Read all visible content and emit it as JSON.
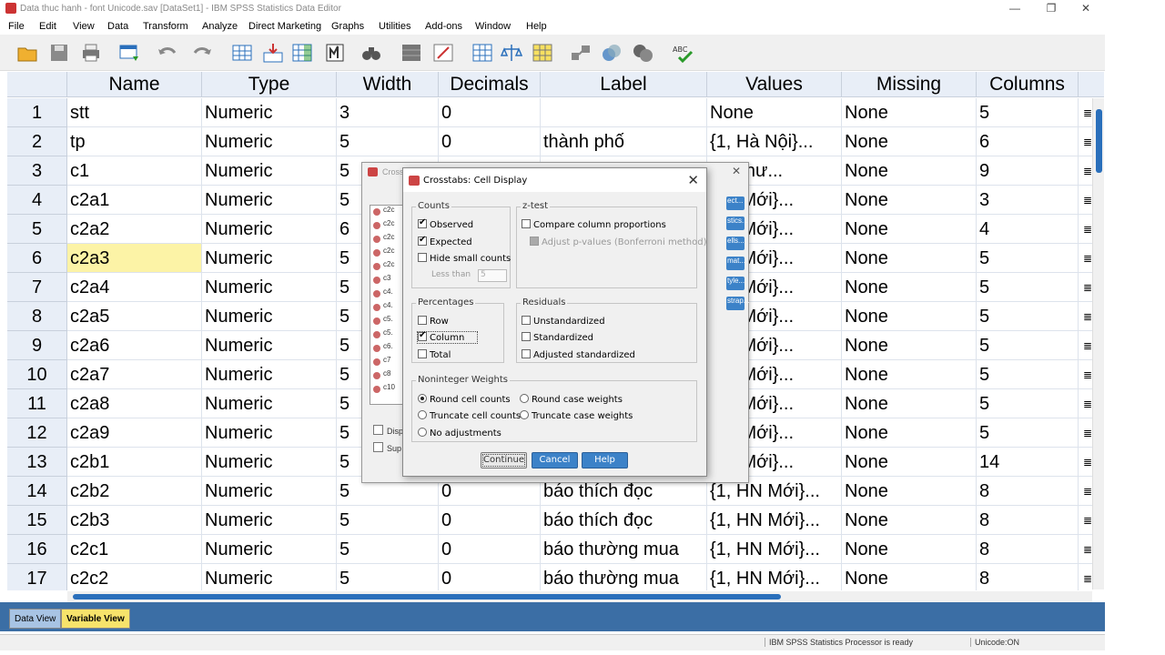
{
  "window": {
    "title": "Data thuc hanh - font Unicode.sav [DataSet1] - IBM SPSS Statistics Data Editor",
    "minimize": "—",
    "restore": "❐",
    "close": "✕"
  },
  "menu": [
    "File",
    "Edit",
    "View",
    "Data",
    "Transform",
    "Analyze",
    "Direct Marketing",
    "Graphs",
    "Utilities",
    "Add-ons",
    "Window",
    "Help"
  ],
  "toolbar_icons": [
    "open-icon",
    "save-icon",
    "print-icon",
    "recall-dialog-icon",
    "undo-icon",
    "redo-icon",
    "goto-case-icon",
    "goto-variable-icon",
    "variables-icon",
    "run-descriptive-icon",
    "find-icon",
    "insert-cases-icon",
    "insert-variable-icon",
    "split-file-icon",
    "weight-cases-icon",
    "select-cases-icon",
    "value-labels-icon",
    "use-sets-icon",
    "show-all-variables-icon",
    "spelling-icon"
  ],
  "grid": {
    "columns": [
      "Name",
      "Type",
      "Width",
      "Decimals",
      "Label",
      "Values",
      "Missing",
      "Columns"
    ],
    "rows": [
      {
        "num": "1",
        "name": "stt",
        "type": "Numeric",
        "width": "3",
        "decimals": "0",
        "label": "",
        "values": "None",
        "missing": "None",
        "columns": "5"
      },
      {
        "num": "2",
        "name": "tp",
        "type": "Numeric",
        "width": "5",
        "decimals": "0",
        "label": "thành phố",
        "values": "{1, Hà Nội}...",
        "missing": "None",
        "columns": "6"
      },
      {
        "num": "3",
        "name": "c1",
        "type": "Numeric",
        "width": "5",
        "decimals": "",
        "label": "",
        "values": "ầu như...",
        "missing": "None",
        "columns": "9"
      },
      {
        "num": "4",
        "name": "c2a1",
        "type": "Numeric",
        "width": "5",
        "decimals": "",
        "label": "",
        "values": "HN Mới}...",
        "missing": "None",
        "columns": "3"
      },
      {
        "num": "5",
        "name": "c2a2",
        "type": "Numeric",
        "width": "6",
        "decimals": "",
        "label": "",
        "values": "HN Mới}...",
        "missing": "None",
        "columns": "4"
      },
      {
        "num": "6",
        "name": "c2a3",
        "type": "Numeric",
        "width": "5",
        "decimals": "",
        "label": "",
        "values": "HN Mới}...",
        "missing": "None",
        "columns": "5"
      },
      {
        "num": "7",
        "name": "c2a4",
        "type": "Numeric",
        "width": "5",
        "decimals": "",
        "label": "",
        "values": "HN Mới}...",
        "missing": "None",
        "columns": "5"
      },
      {
        "num": "8",
        "name": "c2a5",
        "type": "Numeric",
        "width": "5",
        "decimals": "",
        "label": "",
        "values": "HN Mới}...",
        "missing": "None",
        "columns": "5"
      },
      {
        "num": "9",
        "name": "c2a6",
        "type": "Numeric",
        "width": "5",
        "decimals": "",
        "label": "",
        "values": "HN Mới}...",
        "missing": "None",
        "columns": "5"
      },
      {
        "num": "10",
        "name": "c2a7",
        "type": "Numeric",
        "width": "5",
        "decimals": "",
        "label": "",
        "values": "HN Mới}...",
        "missing": "None",
        "columns": "5"
      },
      {
        "num": "11",
        "name": "c2a8",
        "type": "Numeric",
        "width": "5",
        "decimals": "",
        "label": "",
        "values": "HN Mới}...",
        "missing": "None",
        "columns": "5"
      },
      {
        "num": "12",
        "name": "c2a9",
        "type": "Numeric",
        "width": "5",
        "decimals": "",
        "label": "",
        "values": "HN Mới}...",
        "missing": "None",
        "columns": "5"
      },
      {
        "num": "13",
        "name": "c2b1",
        "type": "Numeric",
        "width": "5",
        "decimals": "",
        "label": "",
        "values": "HN Mới}...",
        "missing": "None",
        "columns": "14"
      },
      {
        "num": "14",
        "name": "c2b2",
        "type": "Numeric",
        "width": "5",
        "decimals": "0",
        "label": "báo thích đọc",
        "values": "{1, HN Mới}...",
        "missing": "None",
        "columns": "8"
      },
      {
        "num": "15",
        "name": "c2b3",
        "type": "Numeric",
        "width": "5",
        "decimals": "0",
        "label": "báo thích đọc",
        "values": "{1, HN Mới}...",
        "missing": "None",
        "columns": "8"
      },
      {
        "num": "16",
        "name": "c2c1",
        "type": "Numeric",
        "width": "5",
        "decimals": "0",
        "label": "báo thường mua",
        "values": "{1, HN Mới}...",
        "missing": "None",
        "columns": "8"
      },
      {
        "num": "17",
        "name": "c2c2",
        "type": "Numeric",
        "width": "5",
        "decimals": "0",
        "label": "báo thường mua",
        "values": "{1, HN Mới}...",
        "missing": "None",
        "columns": "8"
      }
    ]
  },
  "tabs": {
    "data_view": "Data View",
    "variable_view": "Variable View"
  },
  "status": {
    "processor": "IBM SPSS Statistics Processor is ready",
    "unicode": "Unicode:ON"
  },
  "bg_dialog": {
    "title": "Cross",
    "list": [
      "c2c",
      "c2c",
      "c2c",
      "c2c",
      "c2c",
      "c3",
      "c4.",
      "c4.",
      "c5.",
      "c5.",
      "c6.",
      "c7",
      "c8",
      "c10"
    ],
    "buttons": [
      "ect...",
      "stics...",
      "ells...",
      "mat...",
      "tyle...",
      "strap..."
    ],
    "check1": "Disp",
    "check2": "Sup"
  },
  "dialog": {
    "title": "Crosstabs: Cell Display",
    "counts": {
      "label": "Counts",
      "observed": "Observed",
      "expected": "Expected",
      "hide_small": "Hide small counts",
      "less_than": "Less than",
      "less_value": "5"
    },
    "ztest": {
      "label": "z-test",
      "compare": "Compare column proportions",
      "adjust": "Adjust p-values (Bonferroni method)"
    },
    "percentages": {
      "label": "Percentages",
      "row": "Row",
      "column": "Column",
      "total": "Total"
    },
    "residuals": {
      "label": "Residuals",
      "unstd": "Unstandardized",
      "std": "Standardized",
      "adj": "Adjusted standardized"
    },
    "weights": {
      "label": "Noninteger Weights",
      "round_cell": "Round cell counts",
      "round_case": "Round case weights",
      "trunc_cell": "Truncate cell counts",
      "trunc_case": "Truncate case weights",
      "no_adj": "No adjustments"
    },
    "buttons": {
      "continue": "Continue",
      "cancel": "Cancel",
      "help": "Help"
    }
  }
}
